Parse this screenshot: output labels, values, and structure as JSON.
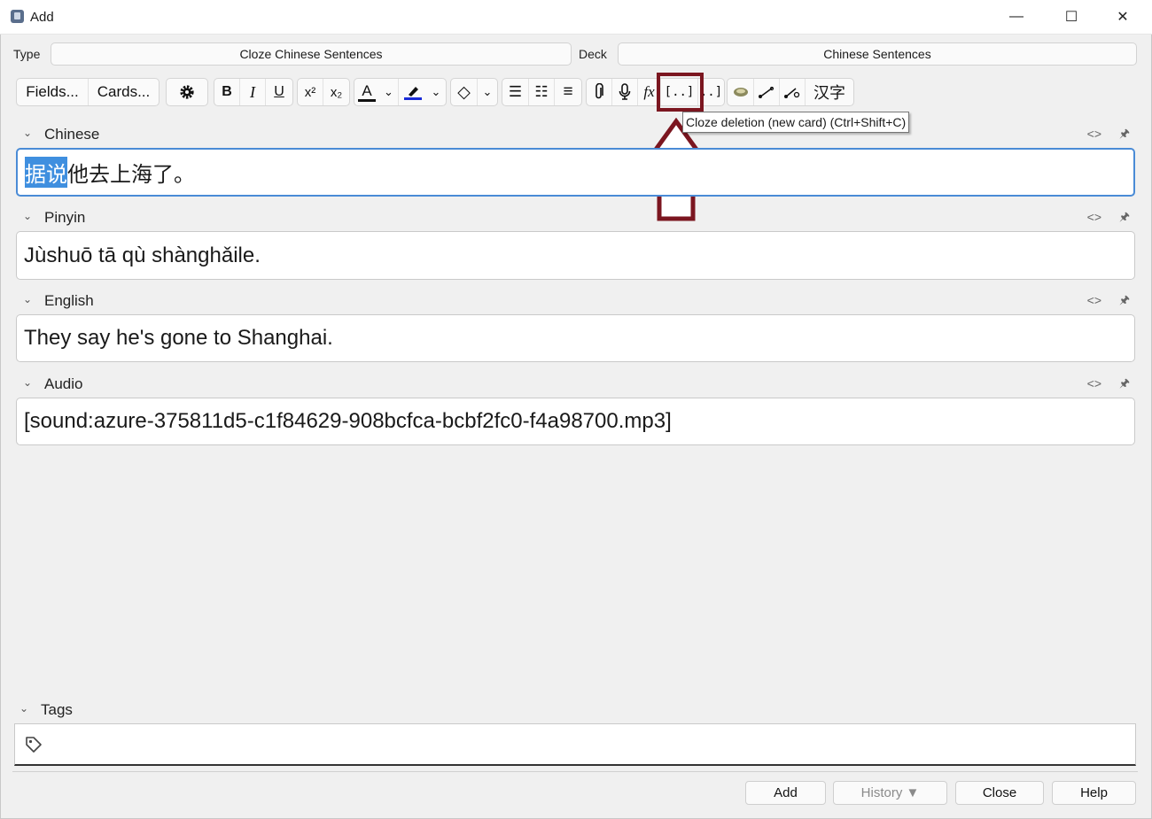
{
  "window": {
    "title": "Add",
    "minimize": "—",
    "maximize": "☐",
    "close": "✕"
  },
  "header": {
    "type_label": "Type",
    "type_value": "Cloze Chinese Sentences",
    "deck_label": "Deck",
    "deck_value": "Chinese Sentences"
  },
  "toolbar": {
    "fields_label": "Fields...",
    "cards_label": "Cards...",
    "bold": "B",
    "italic": "I",
    "underline": "U",
    "superscript": "x²",
    "subscript": "x₂",
    "text_color": "A",
    "chevron": "⌄",
    "eraser": "◇",
    "unordered_list": "☰",
    "ordered_list": "☷",
    "align": "≡",
    "attach": "⌀",
    "record": "🎙",
    "math": "fx",
    "cloze_new": "[..]",
    "cloze_same": "..]",
    "hanzi_label": "汉字",
    "colors": {
      "text_underline": "#111111",
      "highlight_underline": "#1a2bd8"
    }
  },
  "tooltip": "Cloze deletion (new card) (Ctrl+Shift+C)",
  "fields": [
    {
      "name": "Chinese",
      "selected": "据说",
      "value": "他去上海了。"
    },
    {
      "name": "Pinyin",
      "value": "Jùshuō tā qù shànghǎile."
    },
    {
      "name": "English",
      "value": "They say he's gone to Shanghai."
    },
    {
      "name": "Audio",
      "value": "[sound:azure-375811d5-c1f84629-908bcfca-bcbf2fc0-f4a98700.mp3]"
    }
  ],
  "field_controls": {
    "html_toggle": "<>",
    "pin": "⊥"
  },
  "tags": {
    "label": "Tags"
  },
  "buttons": {
    "add": "Add",
    "history": "History ▼",
    "close": "Close",
    "help": "Help"
  },
  "annotation_color": "#7b1620"
}
